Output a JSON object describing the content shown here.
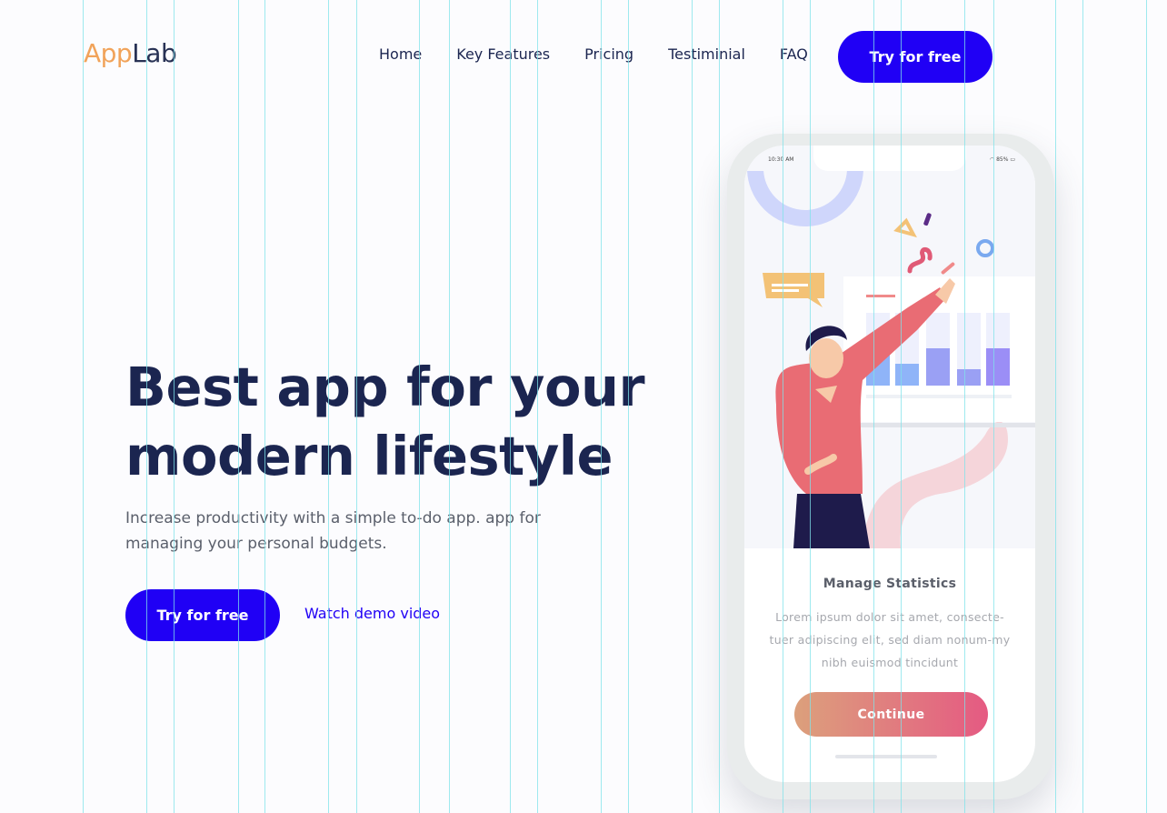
{
  "header": {
    "logo_part1": "App",
    "logo_part2": "Lab",
    "nav": [
      "Home",
      "Key Features",
      "Pricing",
      "Testiminial",
      "FAQ"
    ],
    "cta_label": "Try for free"
  },
  "hero": {
    "title_line1": "Best app for your",
    "title_line2": "modern lifestyle",
    "subtitle": "Increase productivity with a simple to-do app. app for managing your personal budgets.",
    "cta_label": "Try for free",
    "demo_link": "Watch demo video"
  },
  "phone": {
    "status_time": "10:30 AM",
    "status_battery": "85%",
    "card_title": "Manage Statistics",
    "card_text": "Lorem ipsum dolor sit amet, consecte-tuer adipiscing elit, sed diam nonum-my nibh euismod tincidunt",
    "continue_label": "Continue"
  },
  "colors": {
    "accent": "#2000f5",
    "dark_text": "#1b2550",
    "logo_orange": "#f1a35a",
    "gradient_start": "#dca07c",
    "gradient_end": "#e55a82"
  }
}
